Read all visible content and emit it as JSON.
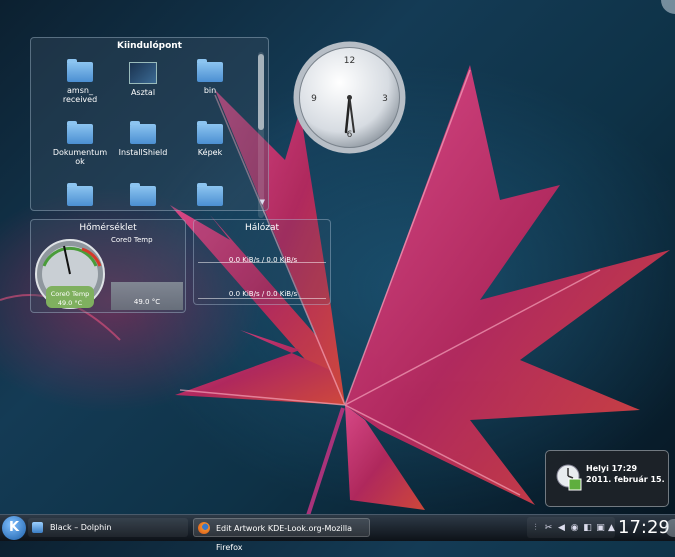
{
  "folder_widget": {
    "title": "Kiindulópont",
    "items": [
      {
        "label": "amsn_\nreceived",
        "icon": "folder-icon"
      },
      {
        "label": "Asztal",
        "icon": "desktop-icon"
      },
      {
        "label": "bin",
        "icon": "folder-icon"
      },
      {
        "label": "Dokumentum\nok",
        "icon": "folder-icon"
      },
      {
        "label": "InstallShield",
        "icon": "folder-icon"
      },
      {
        "label": "Képek",
        "icon": "folder-icon"
      },
      {
        "label": "",
        "icon": "folder-icon"
      },
      {
        "label": "",
        "icon": "folder-icon"
      },
      {
        "label": "",
        "icon": "folder-icon"
      }
    ],
    "scroll_fraction": 0.45
  },
  "clock": {
    "numbers": [
      "12",
      "3",
      "6",
      "9"
    ],
    "time": "17:29"
  },
  "temp_widget": {
    "title": "Hőmérséklet",
    "gauge_label": "Core0 Temp",
    "gauge_value": "49.0 °C",
    "graph_label": "Core0 Temp",
    "graph_value": "49.0 °C"
  },
  "net_widget": {
    "title": "Hálózat",
    "line1": "0.0 KiB/s / 0.0 KiB/s",
    "line2": "0.0 KiB/s / 0.0 KiB/s"
  },
  "clock_popup": {
    "line1": "Helyi 17:29",
    "line2": "2011. február 15."
  },
  "taskbar": {
    "tasks": [
      {
        "label": "Black – Dolphin",
        "icon": "dolphin-icon"
      },
      {
        "label": "Edit Artwork KDE-Look.org-Mozilla Firefox",
        "icon": "firefox-icon"
      }
    ],
    "clock": "17:29"
  },
  "colors": {
    "accent": "#2f7fd0",
    "leaf": "#c4306a"
  }
}
